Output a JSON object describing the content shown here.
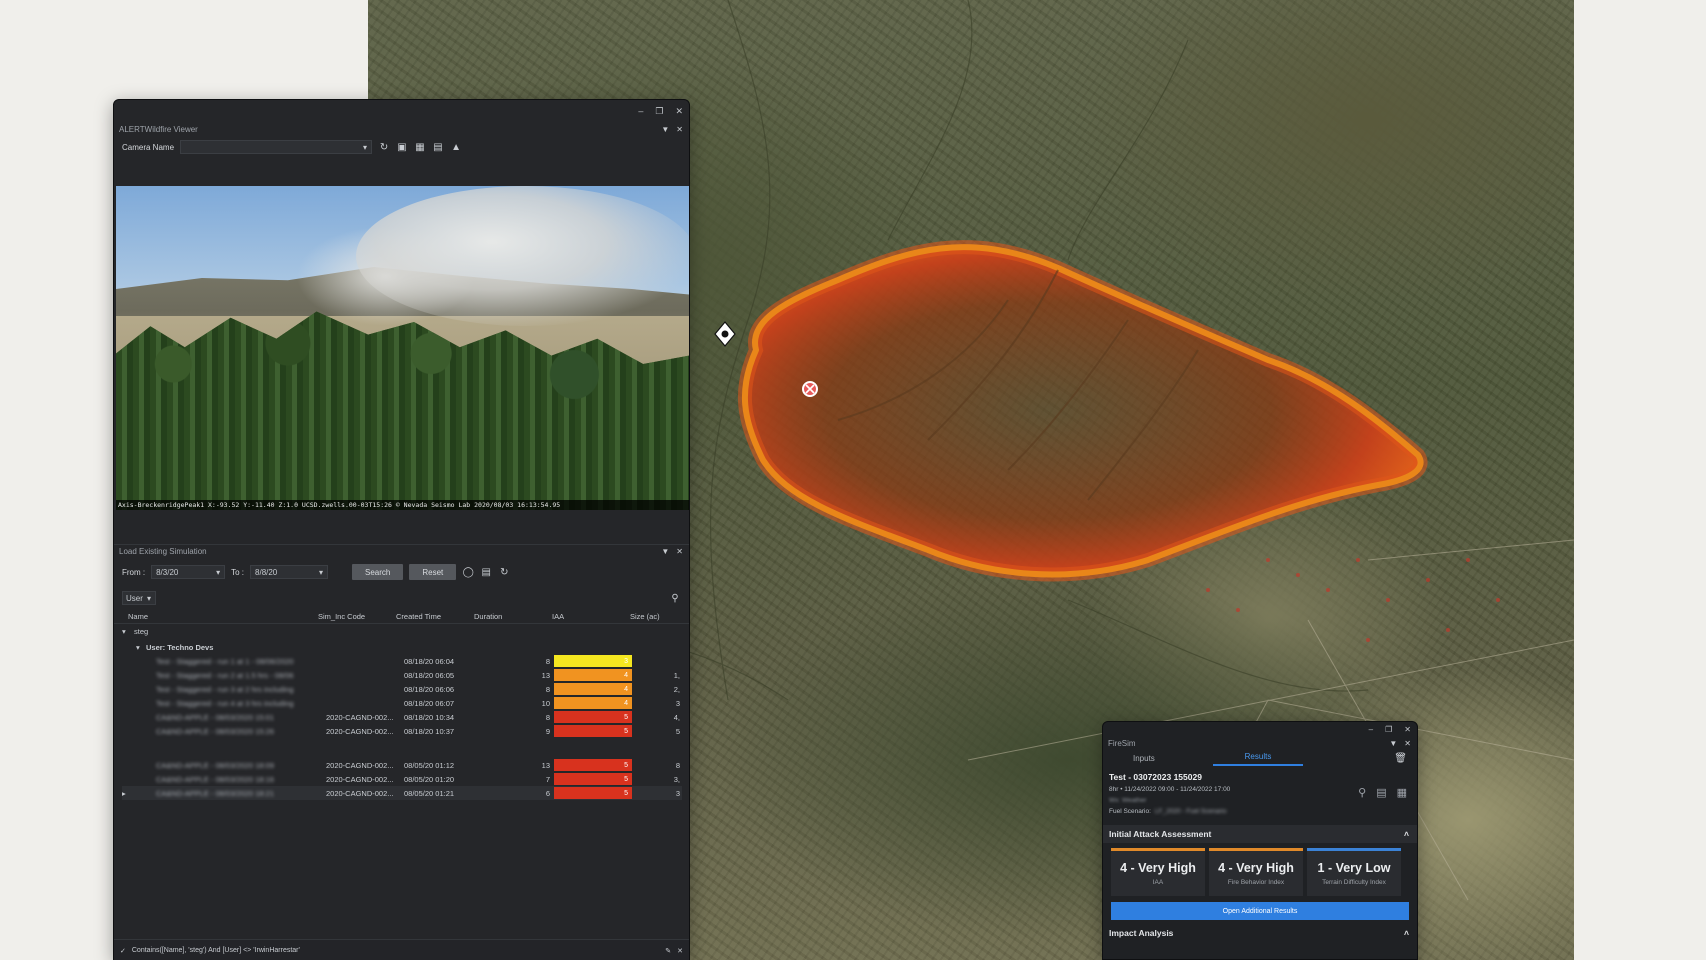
{
  "viewer": {
    "window_title": "ALERTWildfire Viewer",
    "camera_label": "Camera Name",
    "camera_value": "",
    "caption": "Axis-BreckenridgePeak1 X:-93.52 Y:-11.40 Z:1.0 UCSD.zwells.00-03T15:26 © Nevada Seismo Lab 2020/08/03 16:13:54.95"
  },
  "sim": {
    "panel_title": "Load Existing Simulation",
    "from_label": "From :",
    "from_value": "8/3/20",
    "to_label": "To :",
    "to_value": "8/8/20",
    "search_label": "Search",
    "reset_label": "Reset",
    "group_by": "User",
    "columns": [
      "Name",
      "Sim_Inc Code",
      "Created Time",
      "Duration",
      "IAA",
      "Size (ac)"
    ],
    "root_group": "steg",
    "user_group": "User: Techno Devs",
    "rows": [
      {
        "name": "Test - Staggered - run 1 at 1 - 08/06/2020",
        "code": "",
        "created": "08/18/20 06:04",
        "duration": "8",
        "iaa": "3",
        "iaa_color": "#f5e720",
        "size": ""
      },
      {
        "name": "Test - Staggered - run 2 at 1.5 hrs - 08/06",
        "code": "",
        "created": "08/18/20 06:05",
        "duration": "13",
        "iaa": "4",
        "iaa_color": "#f19320",
        "size": "1,"
      },
      {
        "name": "Test - Staggered - run 3 at 2 hrs including",
        "code": "",
        "created": "08/18/20 06:06",
        "duration": "8",
        "iaa": "4",
        "iaa_color": "#f19320",
        "size": "2,"
      },
      {
        "name": "Test - Staggered - run 4 at 3 hrs including",
        "code": "",
        "created": "08/18/20 06:07",
        "duration": "10",
        "iaa": "4",
        "iaa_color": "#f19320",
        "size": "3"
      },
      {
        "name": "CA&ND-APPLE - 08/03/2020 15:01",
        "code": "2020-CAGND-002...",
        "created": "08/18/20 10:34",
        "duration": "8",
        "iaa": "5",
        "iaa_color": "#d8321e",
        "size": "4,"
      },
      {
        "name": "CA&ND-APPLE - 08/03/2020 15:26",
        "code": "2020-CAGND-002...",
        "created": "08/18/20 10:37",
        "duration": "9",
        "iaa": "5",
        "iaa_color": "#d8321e",
        "size": "5"
      },
      {
        "name": "CA&ND-APPLE - 08/03/2020 18:09",
        "code": "2020-CAGND-002...",
        "created": "08/05/20 01:12",
        "duration": "13",
        "iaa": "5",
        "iaa_color": "#d8321e",
        "size": "8"
      },
      {
        "name": "CA&ND-APPLE - 08/03/2020 18:16",
        "code": "2020-CAGND-002...",
        "created": "08/05/20 01:20",
        "duration": "7",
        "iaa": "5",
        "iaa_color": "#d8321e",
        "size": "3,"
      },
      {
        "name": "CA&ND-APPLE - 08/03/2020 18:21",
        "code": "2020-CAGND-002...",
        "created": "08/05/20 01:21",
        "duration": "6",
        "iaa": "5",
        "iaa_color": "#d8321e",
        "size": "3"
      }
    ],
    "filter_text": "Contains([Name], 'steg') And [User] <> 'IrwinHarrestar'"
  },
  "firesim": {
    "window_title": "FireSim",
    "tab_inputs": "Inputs",
    "tab_results": "Results",
    "run_title": "Test - 03072023 155029",
    "time_range": "8hr • 11/24/2022 09:00 - 11/24/2022 17:00",
    "weather_line": "Wx: Weather",
    "fuel_label": "Fuel Scenario:",
    "fuel_value": "LF_2020 - Fuel Scenario",
    "section_title": "Initial Attack Assessment",
    "tiles": [
      {
        "value": "4 - Very High",
        "label": "IAA",
        "color": "#e08a2a"
      },
      {
        "value": "4 - Very High",
        "label": "Fire Behavior Index",
        "color": "#e08a2a"
      },
      {
        "value": "1 - Very Low",
        "label": "Terrain Difficulty Index",
        "color": "#3b82d6"
      }
    ],
    "open_results_label": "Open Additional Results",
    "impact_title": "Impact Analysis"
  },
  "colors": {
    "accent_blue": "#2f7fe0",
    "fire_orange": "#e0561a",
    "fire_yellow": "#f5d21a"
  }
}
